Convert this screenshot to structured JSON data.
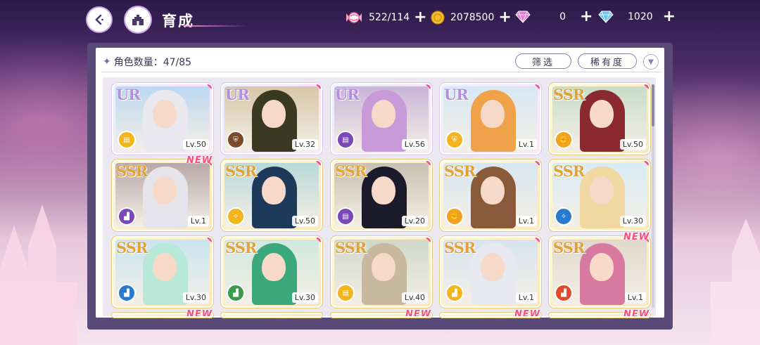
{
  "header": {
    "title": "育成",
    "resources": [
      {
        "icon": "candy-icon",
        "value": "522/114"
      },
      {
        "icon": "gold-coin-icon",
        "value": "2078500"
      },
      {
        "icon": "pink-diamond-icon",
        "value": "0"
      },
      {
        "icon": "blue-diamond-icon",
        "value": "1020"
      }
    ]
  },
  "toolbar": {
    "count_label": "角色数量：47/85",
    "filter_label": "筛选",
    "rarity_label": "稀有度"
  },
  "colors": {
    "accent": "#5a4a78",
    "new": "#ff4a86",
    "ur": "#b48de0",
    "ssr": "#e1a23a"
  },
  "cards": [
    {
      "rarity": "UR",
      "attr_color": "#f2b51e",
      "attr_icon": "book-icon",
      "level": "Lv.50",
      "new": false,
      "hair": "#e8e8ee",
      "bg": "#bcd8f0"
    },
    {
      "rarity": "UR",
      "attr_color": "#7a4a2a",
      "attr_icon": "shield-icon",
      "level": "Lv.32",
      "new": false,
      "hair": "#3a3a22",
      "bg": "#d8c6a8"
    },
    {
      "rarity": "UR",
      "attr_color": "#7a48b8",
      "attr_icon": "book-icon",
      "level": "Lv.56",
      "new": false,
      "hair": "#c89ad8",
      "bg": "#c8b4d8"
    },
    {
      "rarity": "UR",
      "attr_color": "#f2b51e",
      "attr_icon": "shield-icon",
      "level": "Lv.1",
      "new": false,
      "hair": "#f0a24a",
      "bg": "#d6e8f4"
    },
    {
      "rarity": "SSR",
      "attr_color": "#f2a21e",
      "attr_icon": "fist-icon",
      "level": "Lv.50",
      "new": false,
      "hair": "#8a2a30",
      "bg": "#c8dcc8"
    },
    {
      "rarity": "SSR",
      "attr_color": "#7a48b8",
      "attr_icon": "boot-icon",
      "level": "Lv.1",
      "new": true,
      "hair": "#e4e4ea",
      "bg": "#b8a8a8"
    },
    {
      "rarity": "SSR",
      "attr_color": "#f2b51e",
      "attr_icon": "wand-icon",
      "level": "Lv.50",
      "new": false,
      "hair": "#1e3a5a",
      "bg": "#b8d8d8"
    },
    {
      "rarity": "SSR",
      "attr_color": "#7a48b8",
      "attr_icon": "book-icon",
      "level": "Lv.20",
      "new": false,
      "hair": "#1a1a2a",
      "bg": "#c8c0b0"
    },
    {
      "rarity": "SSR",
      "attr_color": "#f2a21e",
      "attr_icon": "fist-icon",
      "level": "Lv.1",
      "new": false,
      "hair": "#8a5a3a",
      "bg": "#d8e6f0"
    },
    {
      "rarity": "SSR",
      "attr_color": "#2a7ad0",
      "attr_icon": "wand-icon",
      "level": "Lv.30",
      "new": false,
      "hair": "#f0d8a0",
      "bg": "#d8ecf6"
    },
    {
      "rarity": "SSR",
      "attr_color": "#2a7ad0",
      "attr_icon": "boot-icon",
      "level": "Lv.30",
      "new": false,
      "hair": "#b8e8d8",
      "bg": "#c8e4f0"
    },
    {
      "rarity": "SSR",
      "attr_color": "#3a9a4a",
      "attr_icon": "boot-icon",
      "level": "Lv.30",
      "new": false,
      "hair": "#3aa87a",
      "bg": "#d0e8e0"
    },
    {
      "rarity": "SSR",
      "attr_color": "#f2b51e",
      "attr_icon": "book-icon",
      "level": "Lv.40",
      "new": false,
      "hair": "#c8b8a0",
      "bg": "#d0d8c8"
    },
    {
      "rarity": "SSR",
      "attr_color": "#f2b51e",
      "attr_icon": "boot-icon",
      "level": "Lv.1",
      "new": false,
      "hair": "#e8e8f0",
      "bg": "#d8e4f0"
    },
    {
      "rarity": "SSR",
      "attr_color": "#e04a2a",
      "attr_icon": "boot-icon",
      "level": "Lv.1",
      "new": true,
      "hair": "#d87aa0",
      "bg": "#e0d8cc"
    }
  ],
  "next_row_new_flags": [
    true,
    false,
    true,
    true,
    true
  ],
  "new_label": "NEW"
}
